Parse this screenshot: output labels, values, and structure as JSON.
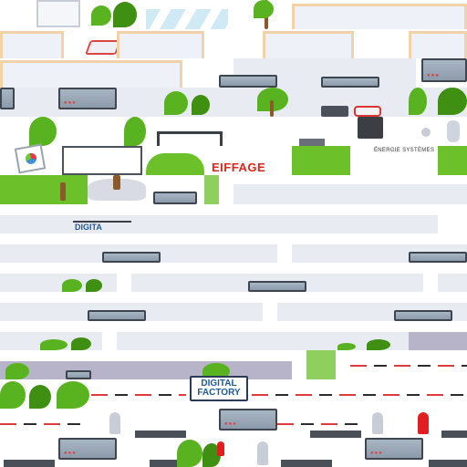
{
  "scene": {
    "type": "isometric office illustration (tiled, scrambled)",
    "colors": {
      "background": "#ffffff",
      "floor_panel": "#e8ebf2",
      "desk_trim": "#f2d2a8",
      "plant_green": "#59b21f",
      "plant_dark": "#3f8f13",
      "monitor": "#95a5b5",
      "brand_red": "#e0251b",
      "sign_blue": "#1e5a9a",
      "lavender_band": "#b7b3c8"
    }
  },
  "brand": {
    "name": "EIFFAGE",
    "subtitle": "ÉNERGIE SYSTÈMES"
  },
  "sign": {
    "line1": "DIGITAL",
    "line2": "FACTORY",
    "partial": "DIGITA"
  },
  "monitor_leds": "●●●",
  "icons": [
    "plant-icon",
    "tree-icon",
    "monitor-icon",
    "presentation-board-icon",
    "printer-icon",
    "coffee-machine-icon",
    "robot-arm-icon",
    "bollard-icon",
    "fire-hydrant-icon"
  ]
}
